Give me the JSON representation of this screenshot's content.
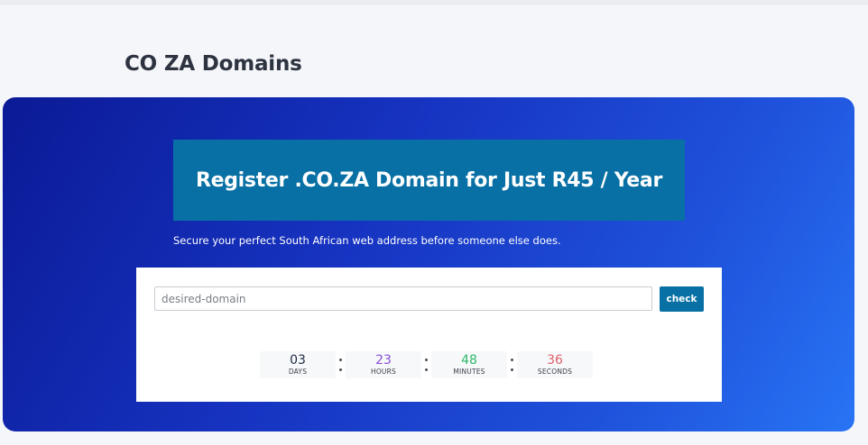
{
  "page": {
    "title": "CO ZA Domains"
  },
  "hero": {
    "heading": "Register .CO.ZA Domain for Just R45 / Year",
    "tagline": "Secure your perfect South African web address before someone else does.",
    "gradient_colors": [
      "#0b1a96",
      "#2874f5"
    ],
    "banner_color": "#0870a4"
  },
  "search": {
    "placeholder": "desired-domain",
    "value": "",
    "button_label": "check"
  },
  "countdown": {
    "days": {
      "value": "03",
      "label": "DAYS",
      "color": "#1f2a44"
    },
    "hours": {
      "value": "23",
      "label": "HOURS",
      "color": "#8a4fd8"
    },
    "minutes": {
      "value": "48",
      "label": "MINUTES",
      "color": "#2fb86a"
    },
    "seconds": {
      "value": "36",
      "label": "SECONDS",
      "color": "#e0626a"
    }
  }
}
